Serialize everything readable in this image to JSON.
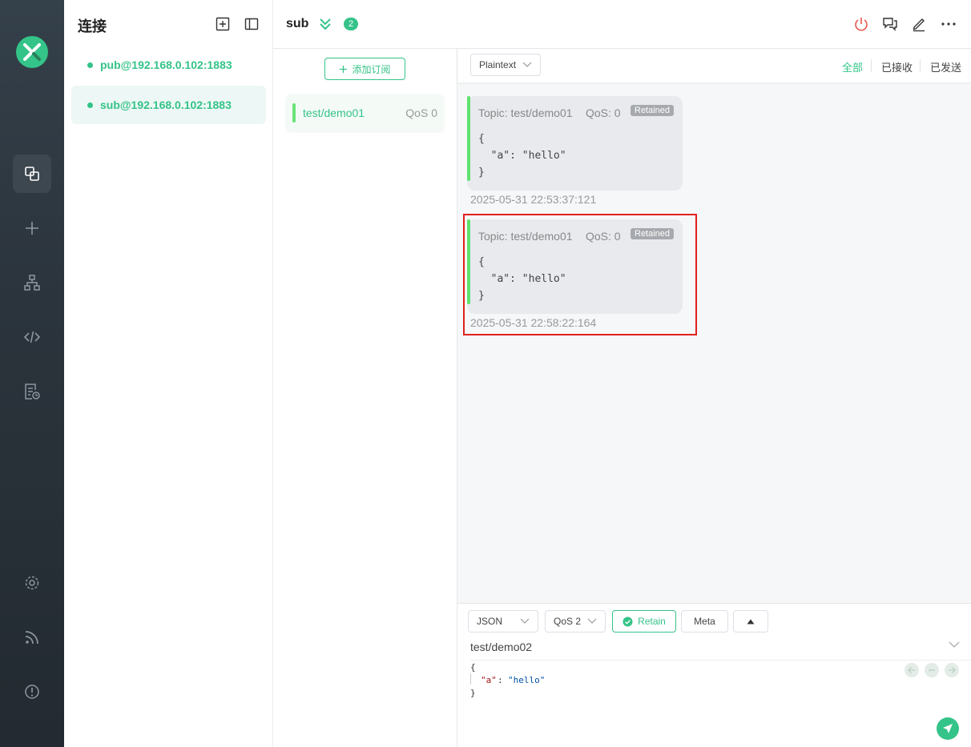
{
  "colors": {
    "accent": "#34c388",
    "rail_bg": "#2b343c",
    "retained_bg": "#a6a9ae",
    "highlight": "#e0201f"
  },
  "rail": {
    "logo": "mqttx-logo-icon",
    "items": [
      {
        "icon": "connections-icon",
        "active": true
      },
      {
        "icon": "plus-icon"
      },
      {
        "icon": "topology-icon"
      },
      {
        "icon": "code-icon"
      },
      {
        "icon": "log-icon"
      },
      {
        "icon": "settings-icon"
      },
      {
        "icon": "rss-icon"
      },
      {
        "icon": "info-icon"
      }
    ]
  },
  "connections": {
    "title": "连接",
    "items": [
      {
        "label": "pub@192.168.0.102:1883",
        "active": false
      },
      {
        "label": "sub@192.168.0.102:1883",
        "active": true
      }
    ]
  },
  "header": {
    "name": "sub",
    "badge": "2"
  },
  "subscriptions": {
    "add_label": "添加订阅",
    "items": [
      {
        "topic": "test/demo01",
        "qos": "QoS 0"
      }
    ]
  },
  "messages": {
    "format": "Plaintext",
    "filters": [
      "全部",
      "已接收",
      "已发送"
    ],
    "items": [
      {
        "topic": "Topic: test/demo01",
        "qos": "QoS: 0",
        "tag": "Retained",
        "payload": [
          "{",
          "  \"a\": \"hello\"",
          "}"
        ],
        "time": "2025-05-31 22:53:37:121"
      },
      {
        "topic": "Topic: test/demo01",
        "qos": "QoS: 0",
        "tag": "Retained",
        "payload": [
          "{",
          "  \"a\": \"hello\"",
          "}"
        ],
        "time": "2025-05-31 22:58:22:164"
      }
    ]
  },
  "composer": {
    "format": "JSON",
    "qos": "QoS 2",
    "retain_label": "Retain",
    "meta_label": "Meta",
    "topic": "test/demo02",
    "payload": [
      "{",
      "\"a\"",
      ": ",
      "\"hello\"",
      "}"
    ]
  }
}
